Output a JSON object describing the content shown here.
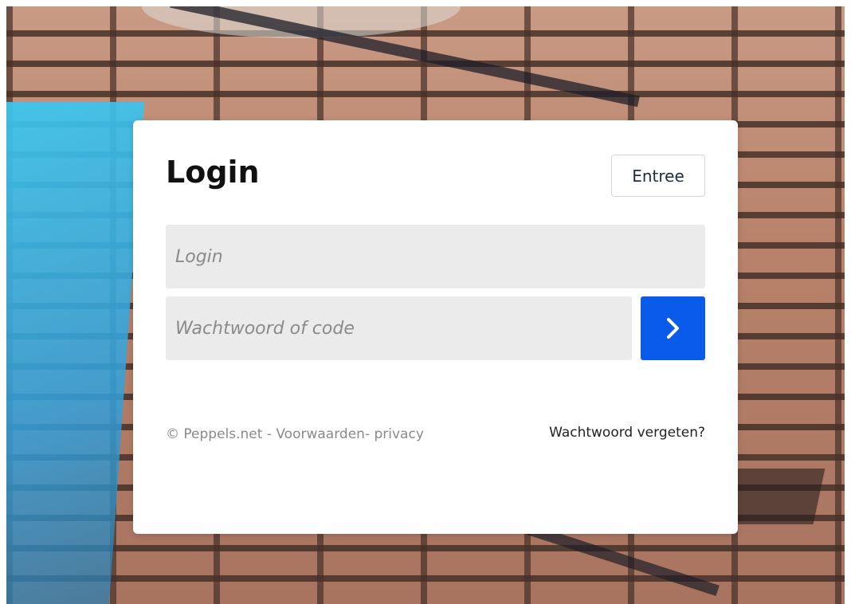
{
  "login_card": {
    "title": "Login",
    "entree_button": "Entree",
    "login_field": {
      "value": "",
      "placeholder": "Login"
    },
    "password_field": {
      "value": "",
      "placeholder": "Wachtwoord of code"
    },
    "submit_icon": "chevron-right-icon",
    "footer": {
      "copyright": "© Peppels.net - ",
      "terms_link": "Voorwaarden",
      "separator": "- ",
      "privacy_link": "privacy",
      "forgot_password": "Wachtwoord vergeten?"
    }
  },
  "colors": {
    "accent": "#0a5bea",
    "field_background": "#ebebeb",
    "card_background": "#ffffff"
  }
}
